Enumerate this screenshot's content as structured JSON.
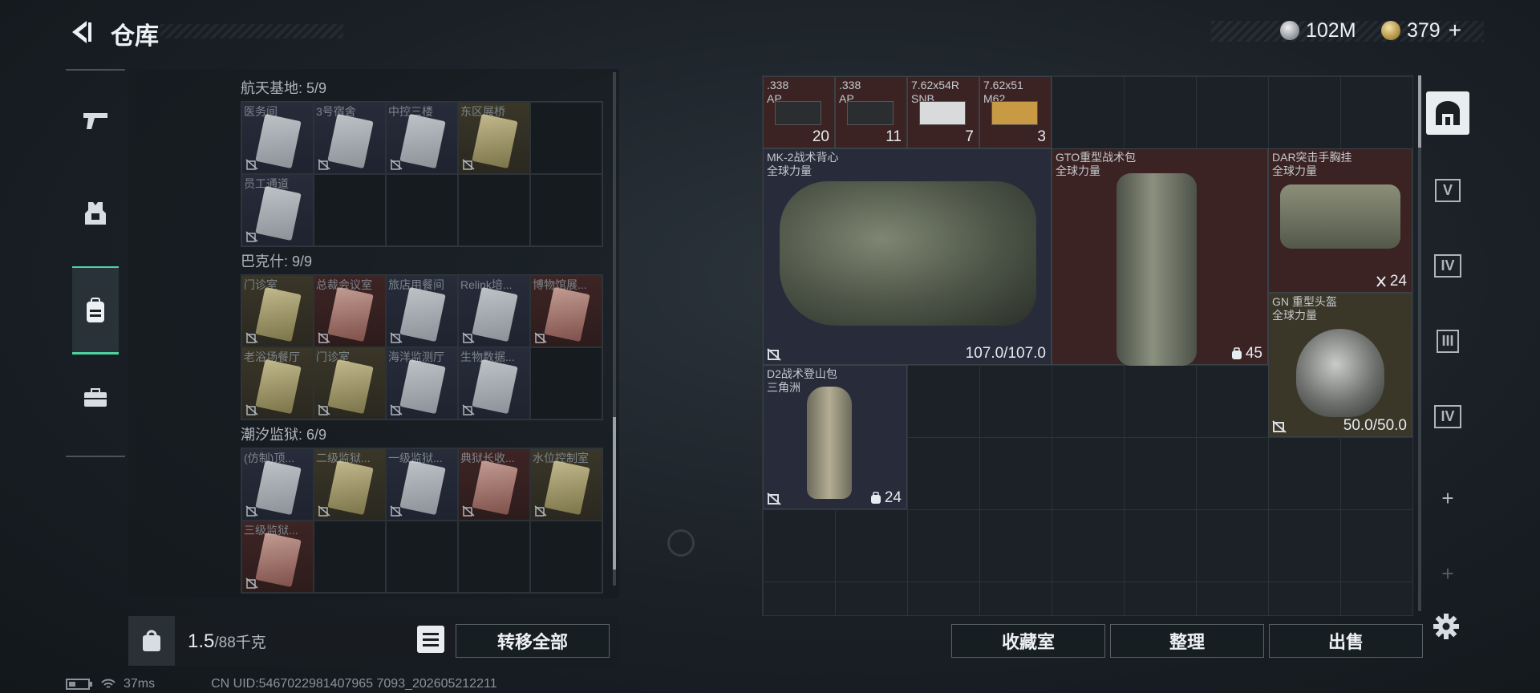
{
  "header": {
    "title": "仓库",
    "currency_silver": "102M",
    "currency_gold": "379",
    "plus_label": "+"
  },
  "left_nav": {
    "items": [
      {
        "icon": "pistol-icon"
      },
      {
        "icon": "armor-icon"
      },
      {
        "icon": "backpack-icon",
        "active": true
      },
      {
        "icon": "toolbox-icon"
      }
    ]
  },
  "locations": [
    {
      "title": "航天基地: 5/9",
      "cells": [
        {
          "name": "医务间",
          "tone": "blue"
        },
        {
          "name": "3号宿舍",
          "tone": "blue"
        },
        {
          "name": "中控三楼",
          "tone": "blue"
        },
        {
          "name": "东区展桥",
          "tone": "gold"
        },
        {
          "name": "",
          "tone": "empty"
        },
        {
          "name": "员工通道",
          "tone": "blue"
        },
        {
          "name": "",
          "tone": "empty"
        },
        {
          "name": "",
          "tone": "empty"
        },
        {
          "name": "",
          "tone": "empty"
        },
        {
          "name": "",
          "tone": "empty"
        }
      ]
    },
    {
      "title": "巴克什: 9/9",
      "cells": [
        {
          "name": "门诊室",
          "tone": "gold"
        },
        {
          "name": "总裁会议室",
          "tone": "red"
        },
        {
          "name": "旅店用餐间",
          "tone": "blue"
        },
        {
          "name": "Relink培...",
          "tone": "blue"
        },
        {
          "name": "博物馆展...",
          "tone": "red"
        },
        {
          "name": "老浴场餐厅",
          "tone": "gold"
        },
        {
          "name": "门诊室",
          "tone": "gold"
        },
        {
          "name": "海洋监测厅",
          "tone": "blue"
        },
        {
          "name": "生物数据...",
          "tone": "blue"
        },
        {
          "name": "",
          "tone": "empty"
        }
      ]
    },
    {
      "title": "潮汐监狱: 6/9",
      "cells": [
        {
          "name": "(仿制)顶...",
          "tone": "blue"
        },
        {
          "name": "二级监狱...",
          "tone": "gold"
        },
        {
          "name": "一级监狱...",
          "tone": "blue"
        },
        {
          "name": "典狱长收...",
          "tone": "red"
        },
        {
          "name": "水位控制室",
          "tone": "gold"
        },
        {
          "name": "三级监狱...",
          "tone": "red"
        },
        {
          "name": "",
          "tone": "empty"
        },
        {
          "name": "",
          "tone": "empty"
        },
        {
          "name": "",
          "tone": "empty"
        },
        {
          "name": "",
          "tone": "empty"
        }
      ]
    }
  ],
  "left_bottom": {
    "weight_value": "1.5",
    "weight_capacity": "/88千克",
    "transfer_all": "转移全部"
  },
  "stash_items": [
    {
      "name1": ".338",
      "name2": "AP",
      "qty": "20",
      "tone": "red"
    },
    {
      "name1": ".338",
      "name2": "AP",
      "qty": "11",
      "tone": "red"
    },
    {
      "name1": "7.62x54R",
      "name2": "SNB",
      "qty": "7",
      "tone": "red"
    },
    {
      "name1": "7.62x51",
      "name2": "M62",
      "qty": "3",
      "tone": "red"
    },
    {
      "name1": "MK-2战术背心",
      "name2": "全球力量",
      "durability": "107.0/107.0",
      "tone": "blue"
    },
    {
      "name1": "GTO重型战术包",
      "name2": "全球力量",
      "capacity": "45",
      "tone": "red"
    },
    {
      "name1": "DAR突击手胸挂",
      "name2": "全球力量",
      "capacity": "24",
      "tone": "red"
    },
    {
      "name1": "GN 重型头盔",
      "name2": "全球力量",
      "durability": "50.0/50.0",
      "tone": "gold"
    },
    {
      "name1": "D2战术登山包",
      "name2": "三角洲",
      "capacity": "24",
      "tone": "blue"
    }
  ],
  "right_tabs": [
    {
      "icon": "stash-icon",
      "label": "",
      "active": true
    },
    {
      "icon": "level-5-storage-icon",
      "label": "V"
    },
    {
      "icon": "level-4-storage-icon",
      "label": "IV"
    },
    {
      "icon": "level-3-storage-icon",
      "label": "III"
    },
    {
      "icon": "level-4-storage-icon",
      "label": "IV"
    },
    {
      "icon": "add-icon",
      "label": "+"
    },
    {
      "icon": "add-icon",
      "label": "+"
    }
  ],
  "right_bottom": {
    "collection_room": "收藏室",
    "organize": "整理",
    "sell": "出售"
  },
  "status": {
    "ping": "37ms",
    "uid": "CN UID:5467022981407965 7093_202605212211"
  },
  "colors": {
    "accent_green": "#4fd2a0",
    "red_tone": "#3e2424",
    "gold_tone": "#3a3628",
    "blue_tone": "#272c3a"
  }
}
